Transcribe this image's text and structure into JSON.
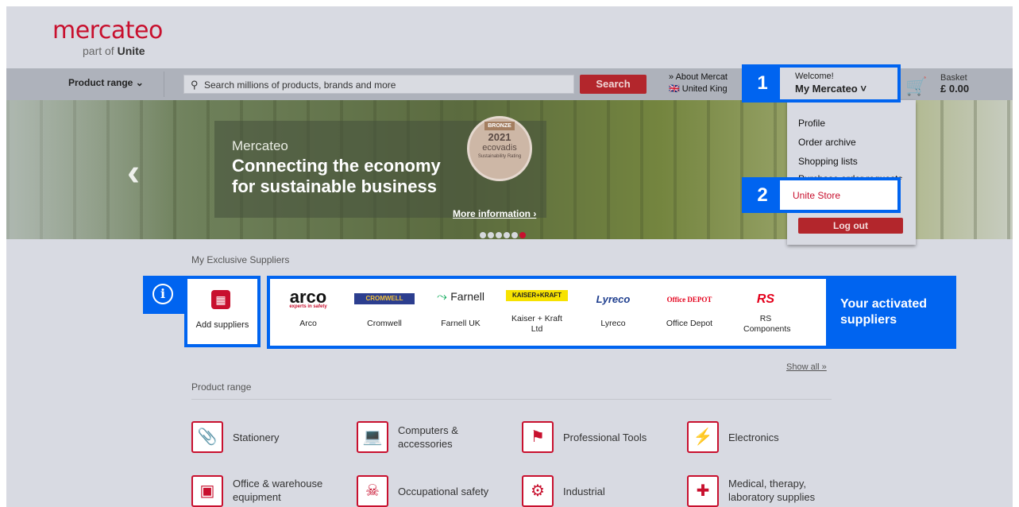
{
  "logo": {
    "brand": "mercateo",
    "part_prefix": "part of ",
    "part_brand": "Unite"
  },
  "nav": {
    "product_range": "Product range",
    "product_range_icon": "chevron-down-icon",
    "search_placeholder": "Search millions of products, brands and more",
    "search_button": "Search",
    "about": "» About Mercat",
    "country": "United King",
    "basket_label": "Basket",
    "basket_amount": "£ 0.00"
  },
  "account": {
    "badge": "1",
    "welcome": "Welcome!",
    "title": "My Mercateo ˅"
  },
  "dropdown": {
    "items": [
      "Profile",
      "Order archive",
      "Shopping lists",
      "Purchase order requests"
    ],
    "unite_badge": "2",
    "unite_store": "Unite Store",
    "logout": "Log out"
  },
  "hero": {
    "kicker": "Mercateo",
    "headline_1": "Connecting the economy",
    "headline_2": "for sustainable business",
    "more": "More information ›",
    "badge_level": "BRONZE",
    "badge_year": "2021",
    "badge_brand": "ecovadis",
    "badge_sub": "Sustainability Rating",
    "slides_total": 6,
    "active_slide": 6
  },
  "suppliers": {
    "heading": "My Exclusive Suppliers",
    "info_icon": "i",
    "add_label": "Add suppliers",
    "caption": "Your activated suppliers",
    "items": [
      {
        "logo": "arco",
        "sublogo": "experts in safety",
        "name": "Arco"
      },
      {
        "logo": "CROMWELL",
        "name": "Cromwell"
      },
      {
        "logo": "Farnell",
        "name": "Farnell UK"
      },
      {
        "logo": "KAISER+KRAFT",
        "name": "Kaiser + Kraft Ltd"
      },
      {
        "logo": "Lyreco",
        "name": "Lyreco"
      },
      {
        "logo": "Office DEPOT",
        "name": "Office Depot"
      },
      {
        "logo": "RS",
        "name": "RS Components"
      }
    ],
    "show_all": "Show all »"
  },
  "product_range": {
    "heading": "Product range",
    "categories": [
      {
        "label": "Stationery",
        "icon": "paperclip-icon"
      },
      {
        "label": "Computers & accessories",
        "icon": "laptop-icon"
      },
      {
        "label": "Professional Tools",
        "icon": "tool-icon"
      },
      {
        "label": "Electronics",
        "icon": "lightning-icon"
      },
      {
        "label": "Office & warehouse equipment",
        "icon": "forklift-icon"
      },
      {
        "label": "Occupational safety",
        "icon": "safety-icon"
      },
      {
        "label": "Industrial",
        "icon": "gears-icon"
      },
      {
        "label": "Medical, therapy, laboratory supplies",
        "icon": "medical-kit-icon"
      }
    ]
  },
  "colors": {
    "brand_red": "#c8102e",
    "highlight_blue": "#0064f0"
  }
}
